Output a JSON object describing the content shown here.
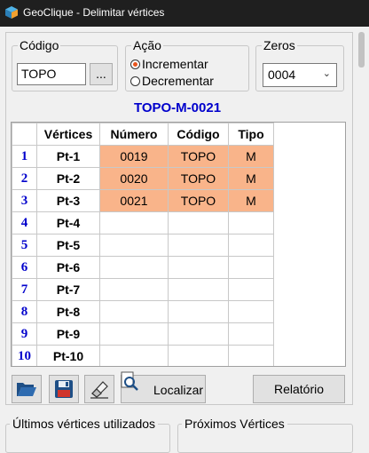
{
  "window": {
    "title": "GeoClique - Delimitar vértices"
  },
  "codigo": {
    "legend": "Código",
    "value": "TOPO",
    "browse_label": "..."
  },
  "acao": {
    "legend": "Ação",
    "options": [
      {
        "label": "Incrementar",
        "selected": true
      },
      {
        "label": "Decrementar",
        "selected": false
      }
    ]
  },
  "zeros": {
    "legend": "Zeros",
    "value": "0004"
  },
  "result_label": "TOPO-M-0021",
  "table": {
    "headers": [
      "Vértices",
      "Número",
      "Código",
      "Tipo"
    ],
    "rows": [
      {
        "index": "1",
        "vertex": "Pt-1",
        "numero": "0019",
        "codigo": "TOPO",
        "tipo": "M"
      },
      {
        "index": "2",
        "vertex": "Pt-2",
        "numero": "0020",
        "codigo": "TOPO",
        "tipo": "M"
      },
      {
        "index": "3",
        "vertex": "Pt-3",
        "numero": "0021",
        "codigo": "TOPO",
        "tipo": "M"
      },
      {
        "index": "4",
        "vertex": "Pt-4",
        "numero": "",
        "codigo": "",
        "tipo": ""
      },
      {
        "index": "5",
        "vertex": "Pt-5",
        "numero": "",
        "codigo": "",
        "tipo": ""
      },
      {
        "index": "6",
        "vertex": "Pt-6",
        "numero": "",
        "codigo": "",
        "tipo": ""
      },
      {
        "index": "7",
        "vertex": "Pt-7",
        "numero": "",
        "codigo": "",
        "tipo": ""
      },
      {
        "index": "8",
        "vertex": "Pt-8",
        "numero": "",
        "codigo": "",
        "tipo": ""
      },
      {
        "index": "9",
        "vertex": "Pt-9",
        "numero": "",
        "codigo": "",
        "tipo": ""
      },
      {
        "index": "10",
        "vertex": "Pt-10",
        "numero": "",
        "codigo": "",
        "tipo": ""
      }
    ]
  },
  "toolbar": {
    "open_icon": "folder-open-icon",
    "save_icon": "floppy-disk-icon",
    "clear_icon": "eraser-icon",
    "locate_icon": "magnifier-document-icon",
    "locate_label": "Localizar",
    "report_label": "Relatório"
  },
  "bottom": {
    "ultimos_legend": "Últimos vértices utilizados",
    "proximos_legend": "Próximos Vértices"
  },
  "colors": {
    "highlight": "#f9b48a",
    "index_blue": "#0000cc",
    "radio_selected": "#e8541c",
    "titlebar": "#1f1f1f"
  }
}
